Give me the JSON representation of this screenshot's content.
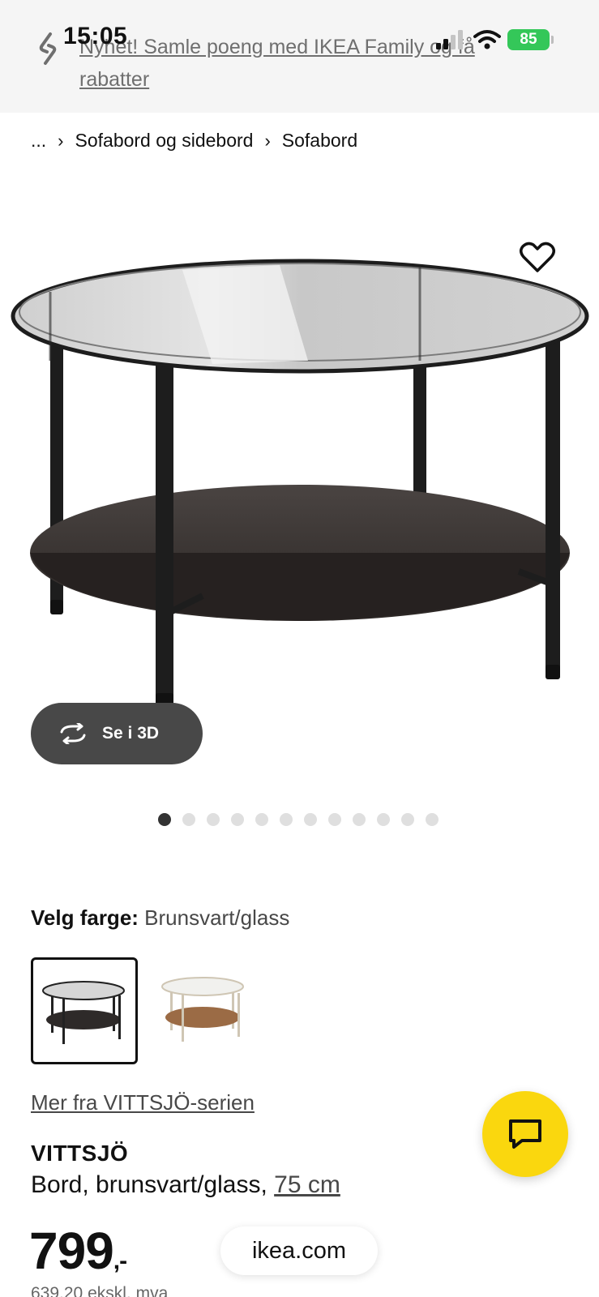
{
  "status_bar": {
    "time": "15:05",
    "battery": "85"
  },
  "promo": {
    "text": "Nyhet! Samle poeng med IKEA Family og få rabatter"
  },
  "breadcrumb": {
    "ellipsis": "...",
    "items": [
      "Sofabord og sidebord",
      "Sofabord"
    ]
  },
  "gallery": {
    "view_3d_label": "Se i 3D",
    "image_count": 12,
    "active_index": 0
  },
  "color": {
    "label": "Velg farge:",
    "value": "Brunsvart/glass"
  },
  "series_link": "Mer fra VITTSJÖ-serien",
  "product": {
    "name": "VITTSJÖ",
    "description": "Bord, brunsvart/glass, ",
    "size": "75 cm",
    "price": "799",
    "price_suffix": ",-",
    "price_ex_vat": "639,20 ekskl. mva"
  },
  "browser": {
    "url": "ikea.com"
  },
  "colors": {
    "accent_yellow": "#fad70e",
    "pill_dark": "#484848",
    "battery_green": "#34c759"
  }
}
